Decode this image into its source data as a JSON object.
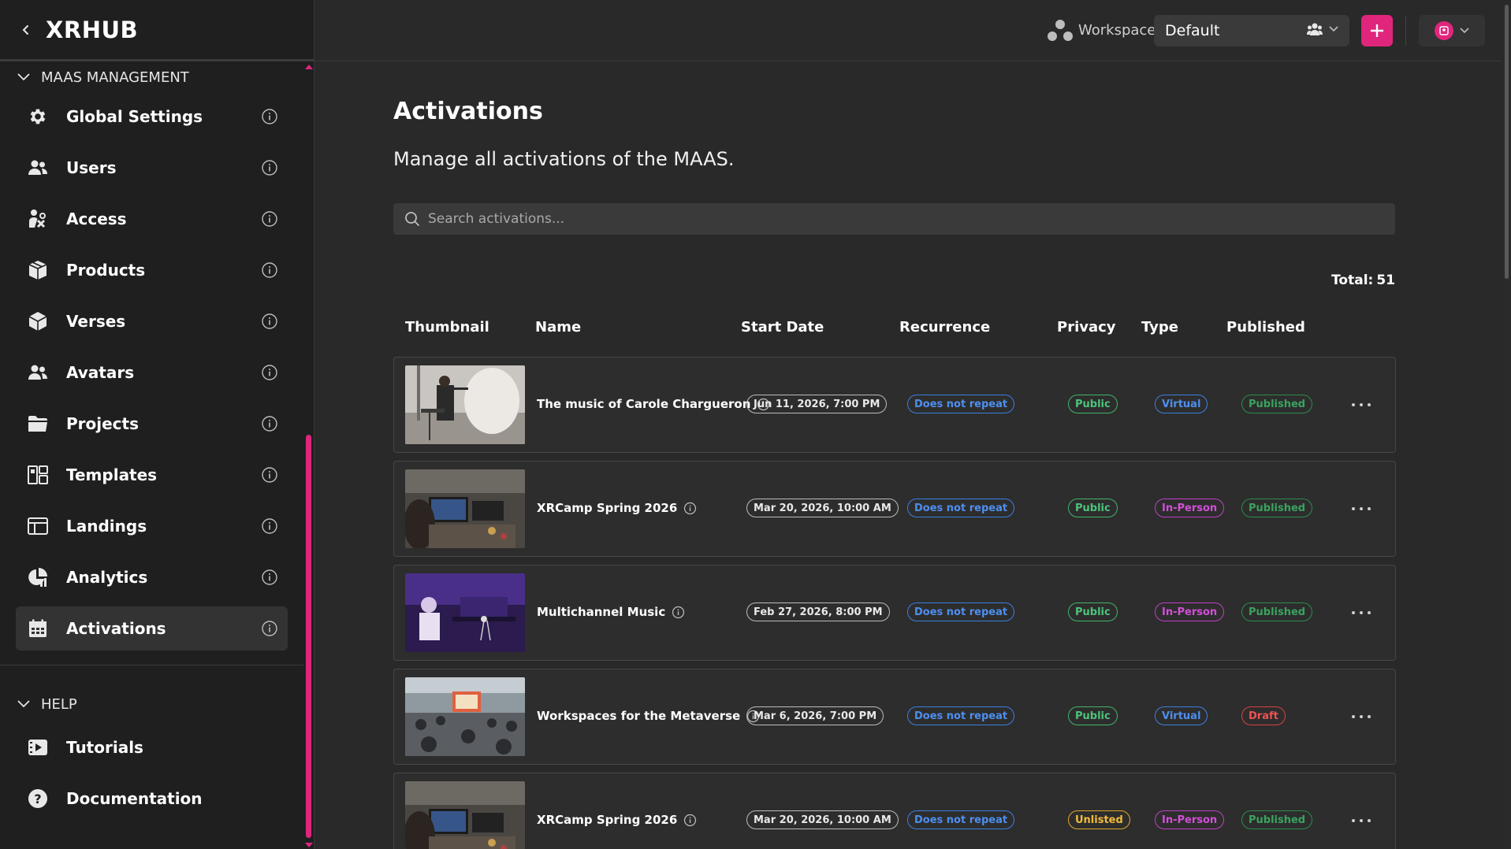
{
  "brand": {
    "title": "XRHUB"
  },
  "sidebar": {
    "section_main": "MAAS MANAGEMENT",
    "items": [
      {
        "label": "Global Settings",
        "icon": "gear-icon"
      },
      {
        "label": "Users",
        "icon": "users-icon"
      },
      {
        "label": "Access",
        "icon": "access-icon"
      },
      {
        "label": "Products",
        "icon": "box-icon"
      },
      {
        "label": "Verses",
        "icon": "cube-icon"
      },
      {
        "label": "Avatars",
        "icon": "avatars-icon"
      },
      {
        "label": "Projects",
        "icon": "folder-icon"
      },
      {
        "label": "Templates",
        "icon": "templates-icon"
      },
      {
        "label": "Landings",
        "icon": "landings-icon"
      },
      {
        "label": "Analytics",
        "icon": "analytics-icon"
      },
      {
        "label": "Activations",
        "icon": "calendar-icon",
        "active": true
      }
    ],
    "section_help": "HELP",
    "help_items": [
      {
        "label": "Tutorials",
        "icon": "tutorials-icon"
      },
      {
        "label": "Documentation",
        "icon": "question-icon"
      }
    ]
  },
  "topbar": {
    "workspace_label": "Workspace",
    "workspace_value": "Default"
  },
  "main": {
    "title": "Activations",
    "subtitle": "Manage all activations of the MAAS.",
    "search_placeholder": "Search activations...",
    "total_label": "Total:",
    "total_value": "51",
    "columns": [
      "Thumbnail",
      "Name",
      "Start Date",
      "Recurrence",
      "Privacy",
      "Type",
      "Published"
    ],
    "rows": [
      {
        "name": "The music of Carole Chargueron",
        "start": "Jun 11, 2026, 7:00 PM",
        "recurrence": "Does not repeat",
        "privacy": "Public",
        "type": "Virtual",
        "published": "Published"
      },
      {
        "name": "XRCamp Spring 2026",
        "start": "Mar 20, 2026, 10:00 AM",
        "recurrence": "Does not repeat",
        "privacy": "Public",
        "type": "In-Person",
        "published": "Published"
      },
      {
        "name": "Multichannel Music",
        "start": "Feb 27, 2026, 8:00 PM",
        "recurrence": "Does not repeat",
        "privacy": "Public",
        "type": "In-Person",
        "published": "Published"
      },
      {
        "name": "Workspaces for the Metaverse",
        "start": "Mar 6, 2026, 7:00 PM",
        "recurrence": "Does not repeat",
        "privacy": "Public",
        "type": "Virtual",
        "published": "Draft"
      },
      {
        "name": "XRCamp Spring 2026",
        "start": "Mar 20, 2026, 10:00 AM",
        "recurrence": "Does not repeat",
        "privacy": "Unlisted",
        "type": "In-Person",
        "published": "Published"
      }
    ]
  },
  "colors": {
    "accent": "#e0257c",
    "background": "#292929",
    "sidebar": "#1f1f1f"
  }
}
